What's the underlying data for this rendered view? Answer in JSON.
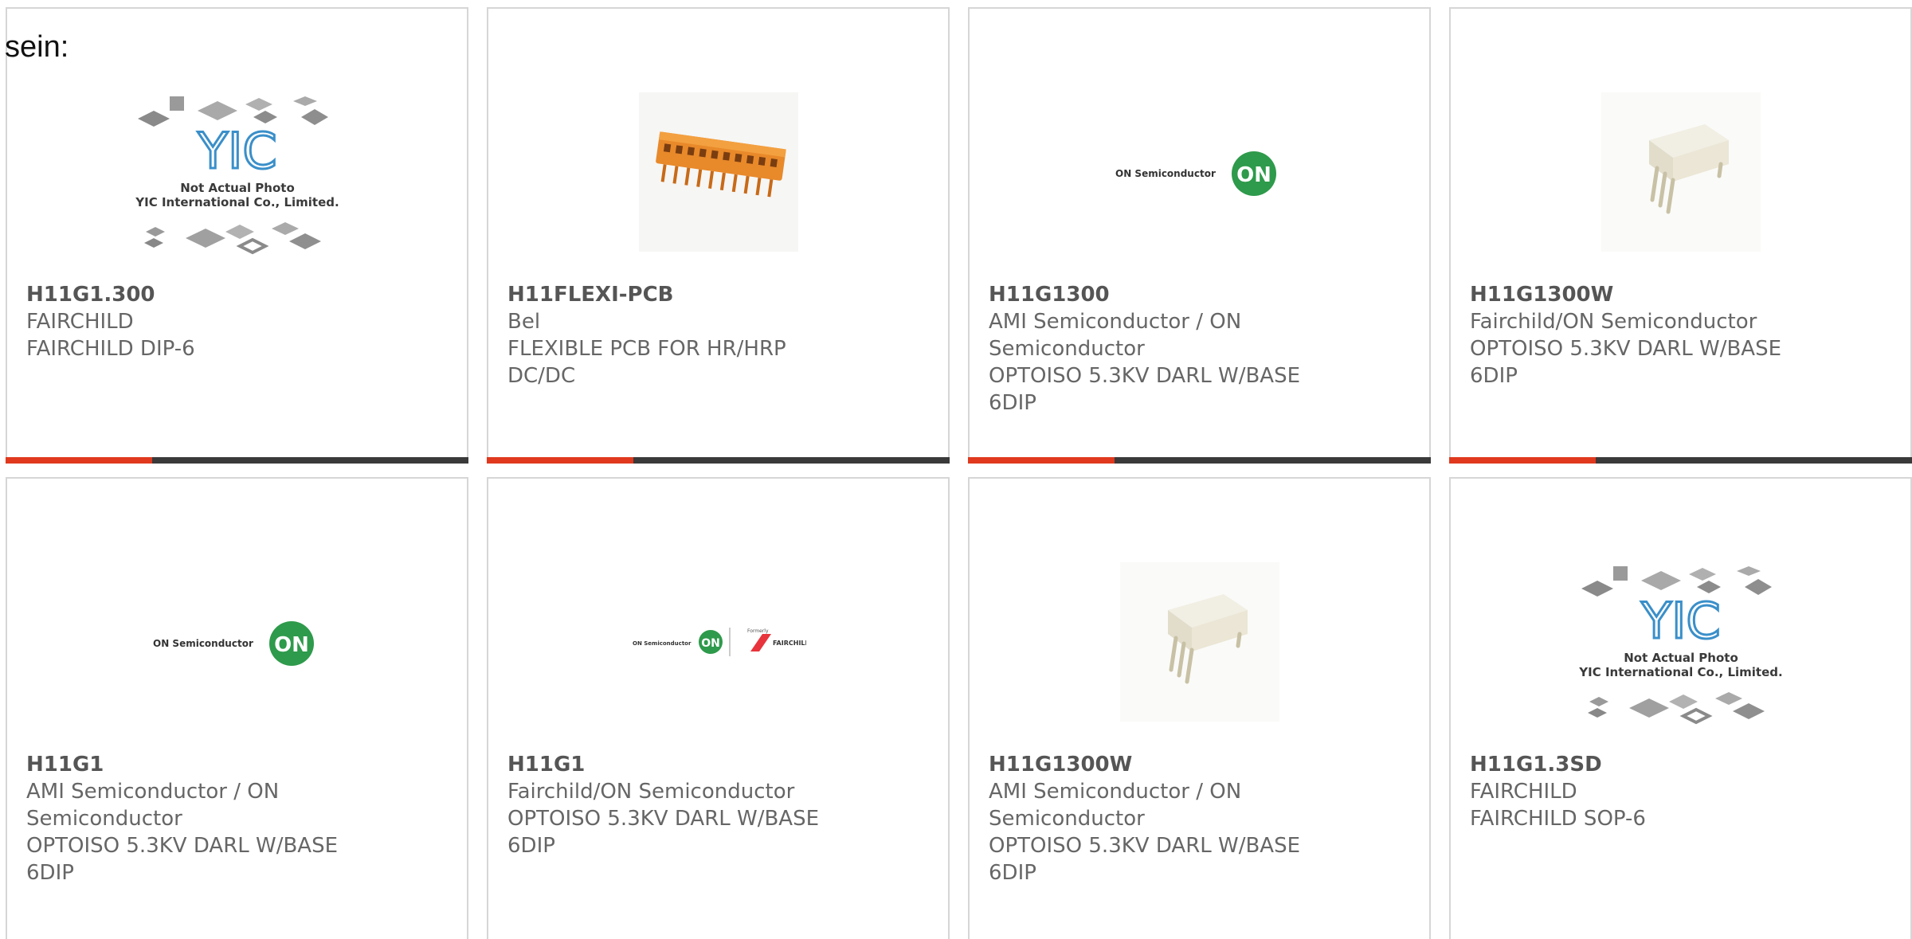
{
  "intro_text": "sein:",
  "logo_text": {
    "yic": "YIC",
    "yic_caption_1": "Not Actual Photo",
    "yic_caption_2": "YIC International Co., Limited.",
    "on_semi": "ON Semiconductor",
    "on_badge": "ON",
    "formerly": "Formerly",
    "fairchild": "FAIRCHILD"
  },
  "colors": {
    "accent": "#e0391e",
    "bar": "#3a3a3a",
    "on_green": "#2e9a4b",
    "fairchild_red": "#e8343c"
  },
  "products": [
    {
      "part": "H11G1.300",
      "maker": "FAIRCHILD",
      "desc": "FAIRCHILD DIP-6",
      "image": "yic-placeholder"
    },
    {
      "part": "H11FLEXI-PCB",
      "maker": "Bel",
      "desc": "FLEXIBLE PCB FOR HR/HRP DC/DC",
      "image": "orange-connector"
    },
    {
      "part": "H11G1300",
      "maker": "AMI Semiconductor / ON Semiconductor",
      "desc": "OPTOISO 5.3KV DARL W/BASE 6DIP",
      "image": "on-semiconductor-logo"
    },
    {
      "part": "H11G1300W",
      "maker": "Fairchild/ON Semiconductor",
      "desc": "OPTOISO 5.3KV DARL W/BASE 6DIP",
      "image": "dip-chip"
    },
    {
      "part": "H11G1",
      "maker": "AMI Semiconductor / ON Semiconductor",
      "desc": "OPTOISO 5.3KV DARL W/BASE 6DIP",
      "image": "on-semiconductor-logo"
    },
    {
      "part": "H11G1",
      "maker": "Fairchild/ON Semiconductor",
      "desc": "OPTOISO 5.3KV DARL W/BASE 6DIP",
      "image": "on-fairchild-logo"
    },
    {
      "part": "H11G1300W",
      "maker": "AMI Semiconductor / ON Semiconductor",
      "desc": "OPTOISO 5.3KV DARL W/BASE 6DIP",
      "image": "dip-chip"
    },
    {
      "part": "H11G1.3SD",
      "maker": "FAIRCHILD",
      "desc": "FAIRCHILD SOP-6",
      "image": "yic-placeholder"
    }
  ]
}
